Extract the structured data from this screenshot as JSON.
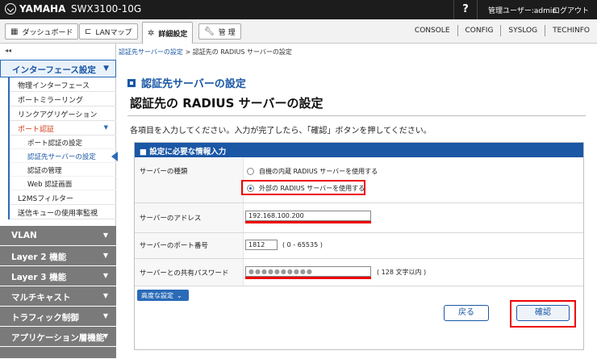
{
  "topbar": {
    "brand": "YAMAHA",
    "model": "SWX3100-10G",
    "help": "?",
    "user": "管理ユーザー:admin",
    "logout": "ログアウト"
  },
  "nav": {
    "tabs": [
      {
        "label": "ダッシュボード",
        "icon": "dashboard-icon"
      },
      {
        "label": "LANマップ",
        "icon": "lanmap-icon"
      },
      {
        "label": "詳細設定",
        "icon": "gear-icon"
      },
      {
        "label": "管 理",
        "icon": "wrench-icon"
      }
    ],
    "links": [
      "CONSOLE",
      "CONFIG",
      "SYSLOG",
      "TECHINFO"
    ]
  },
  "sidebar": {
    "collapse": "◂◂",
    "open_section": "インターフェース設定",
    "items": [
      "物理インターフェース",
      "ポートミラーリング",
      "リンクアグリゲーション",
      "ポート認証"
    ],
    "sub_items": [
      "ポート認証の設定",
      "認証先サーバーの設定",
      "認証の管理",
      "Web 認証画面"
    ],
    "items_after": [
      "L2MSフィルター",
      "送信キューの使用率監視"
    ],
    "closed_sections": [
      "VLAN",
      "Layer 2 機能",
      "Layer 3 機能",
      "マルチキャスト",
      "トラフィック制御",
      "アプリケーション層機能"
    ]
  },
  "main": {
    "breadcrumb_link": "認証先サーバーの設定",
    "breadcrumb_sep": " > ",
    "breadcrumb_current": "認証先の RADIUS サーバーの設定",
    "subheading": "認証先サーバーの設定",
    "title": "認証先の RADIUS サーバーの設定",
    "instruction": "各項目を入力してください。入力が完了したら、「確認」ボタンを押してください。",
    "panel_title": "■ 設定に必要な情報入力",
    "rows": {
      "server_type_label": "サーバーの種類",
      "option_internal": "自機の内蔵 RADIUS サーバーを使用する",
      "option_external": "外部の RADIUS サーバーを使用する",
      "address_label": "サーバーのアドレス",
      "address_value": "192.168.100.200",
      "port_label": "サーバーのポート番号",
      "port_value": "1812",
      "port_hint": "( 0 - 65535 )",
      "secret_label": "サーバーとの共有パスワード",
      "secret_value": "●●●●●●●●●●",
      "secret_hint": "( 128 文字以内 )"
    },
    "advanced_button": "高度な設定",
    "back_button": "戻る",
    "confirm_button": "確認"
  },
  "colors": {
    "accent": "#1a57a5",
    "highlight": "#ee0000",
    "topbar": "#1c1c1c"
  }
}
